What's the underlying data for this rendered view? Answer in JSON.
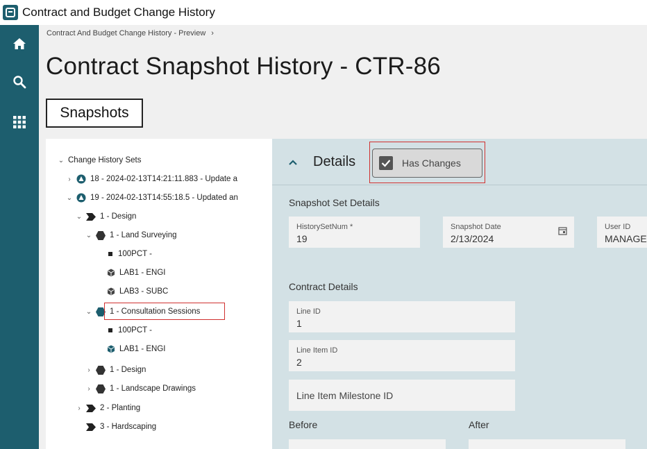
{
  "window": {
    "title": "Contract and Budget Change History"
  },
  "rail": {
    "items": [
      "home-icon",
      "search-icon",
      "apps-grid-icon"
    ]
  },
  "breadcrumb": {
    "current": "Contract And Budget Change History - Preview",
    "separator": "›"
  },
  "page": {
    "title": "Contract Snapshot History - CTR-86"
  },
  "tabs": {
    "snapshots": "Snapshots"
  },
  "tree": {
    "root": "Change History Sets",
    "set18": "18 - 2024-02-13T14:21:11.883 - Update a",
    "set19": "19 - 2024-02-13T14:55:18.5 - Updated an",
    "design1": "1 - Design",
    "landSurveying": "1 - Land Surveying",
    "pct100a": "100PCT -",
    "lab1a": "LAB1 - ENGI",
    "lab3": "LAB3 - SUBC",
    "consultation": "1 - Consultation Sessions",
    "pct100b": "100PCT -",
    "lab1b": "LAB1 - ENGI",
    "design2": "1 - Design",
    "landscape": "1 - Landscape Drawings",
    "planting": "2 - Planting",
    "hardscaping": "3 - Hardscaping"
  },
  "details": {
    "title": "Details",
    "has_changes": "Has Changes",
    "has_changes_checked": true,
    "snapshot_set": {
      "title": "Snapshot Set Details",
      "history_set_num": {
        "label": "HistorySetNum *",
        "value": "19"
      },
      "snapshot_date": {
        "label": "Snapshot Date",
        "value": "2/13/2024"
      },
      "user_id": {
        "label": "User ID",
        "value": "MANAGEI"
      }
    },
    "contract": {
      "title": "Contract Details",
      "line_id": {
        "label": "Line ID",
        "value": "1"
      },
      "line_item_id": {
        "label": "Line Item ID",
        "value": "2"
      },
      "line_item_milestone_id": {
        "placeholder": "Line Item Milestone ID"
      }
    },
    "before": "Before",
    "after": "After"
  },
  "colors": {
    "rail": "#1d5e6e",
    "accent": "#1d5e6e",
    "highlight": "#d0302f",
    "details_bg": "#d3e1e5"
  }
}
